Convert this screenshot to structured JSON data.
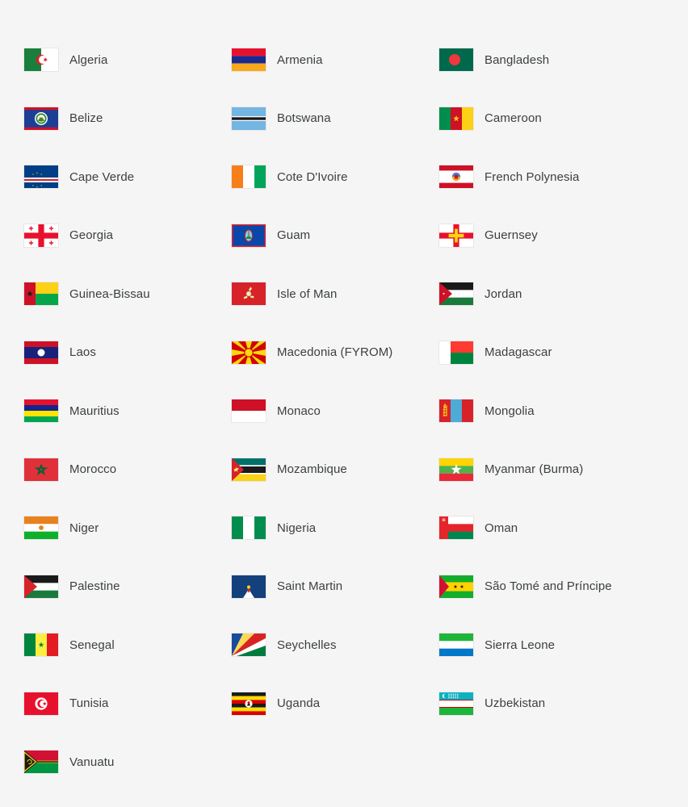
{
  "page": {
    "title": "Country flag list",
    "background_color": "#f5f5f5",
    "text_color": "#3c4043",
    "columns": 3,
    "total_items": 37
  },
  "flags": [
    {
      "name": "Algeria",
      "code": "algeria"
    },
    {
      "name": "Armenia",
      "code": "armenia"
    },
    {
      "name": "Bangladesh",
      "code": "bangladesh"
    },
    {
      "name": "Belize",
      "code": "belize"
    },
    {
      "name": "Botswana",
      "code": "botswana"
    },
    {
      "name": "Cameroon",
      "code": "cameroon"
    },
    {
      "name": "Cape Verde",
      "code": "cape-verde"
    },
    {
      "name": "Cote D'Ivoire",
      "code": "cote-divoire"
    },
    {
      "name": "French Polynesia",
      "code": "french-polynesia"
    },
    {
      "name": "Georgia",
      "code": "georgia"
    },
    {
      "name": "Guam",
      "code": "guam"
    },
    {
      "name": "Guernsey",
      "code": "guernsey"
    },
    {
      "name": "Guinea-Bissau",
      "code": "guinea-bissau"
    },
    {
      "name": "Isle of Man",
      "code": "isle-of-man"
    },
    {
      "name": "Jordan",
      "code": "jordan"
    },
    {
      "name": "Laos",
      "code": "laos"
    },
    {
      "name": "Macedonia (FYROM)",
      "code": "macedonia"
    },
    {
      "name": "Madagascar",
      "code": "madagascar"
    },
    {
      "name": "Mauritius",
      "code": "mauritius"
    },
    {
      "name": "Monaco",
      "code": "monaco"
    },
    {
      "name": "Mongolia",
      "code": "mongolia"
    },
    {
      "name": "Morocco",
      "code": "morocco"
    },
    {
      "name": "Mozambique",
      "code": "mozambique"
    },
    {
      "name": "Myanmar (Burma)",
      "code": "myanmar"
    },
    {
      "name": "Niger",
      "code": "niger"
    },
    {
      "name": "Nigeria",
      "code": "nigeria"
    },
    {
      "name": "Oman",
      "code": "oman"
    },
    {
      "name": "Palestine",
      "code": "palestine"
    },
    {
      "name": "Saint Martin",
      "code": "saint-martin"
    },
    {
      "name": "São Tomé and Príncipe",
      "code": "sao-tome-and-principe"
    },
    {
      "name": "Senegal",
      "code": "senegal"
    },
    {
      "name": "Seychelles",
      "code": "seychelles"
    },
    {
      "name": "Sierra Leone",
      "code": "sierra-leone"
    },
    {
      "name": "Tunisia",
      "code": "tunisia"
    },
    {
      "name": "Uganda",
      "code": "uganda"
    },
    {
      "name": "Uzbekistan",
      "code": "uzbekistan"
    },
    {
      "name": "Vanuatu",
      "code": "vanuatu"
    }
  ],
  "palette": {
    "green_algeria": "#1a7e3c",
    "red": "#d7222a",
    "crimson": "#e8112d",
    "orange": "#f7941e",
    "armenia_blue": "#1b2a8f",
    "bangladesh_green": "#00694b",
    "bangladesh_red": "#f0373e",
    "belize_blue": "#1b3f95",
    "botswana_blue": "#73b5e3",
    "cameroon_green": "#018d4e",
    "cameroon_yellow": "#fcd116",
    "cape_verde_blue": "#003f87",
    "ivory_orange": "#f77f1b",
    "ivory_green": "#00a55a",
    "guam_blue": "#0b47ab",
    "guinea_green": "#05a64b",
    "jordan_black": "#1a1a1a",
    "jordan_green": "#1a7a3c",
    "laos_blue": "#17227a",
    "macedonia_yellow": "#f8d80e",
    "madagascar_red": "#ff3a30",
    "madagascar_green": "#00843d",
    "mauritius_yellow": "#ffe400",
    "monaco_red": "#ce1126",
    "mongolia_blue": "#4eabd6",
    "morocco_red": "#e0303a",
    "mozambique_teal": "#007168",
    "myanmar_yellow": "#ffd400",
    "myanmar_green": "#4eb24e",
    "niger_orange": "#e8821e",
    "nigeria_green": "#018d4e",
    "oman_red": "#e4252b",
    "palestine_green": "#1a7a3c",
    "saint_martin_navy": "#14417c",
    "sao_tome_yellow": "#ffd100",
    "senegal_green": "#00853f",
    "seychelles_blue": "#1a4a9c",
    "sierra_blue": "#0077c8",
    "tunisia_red": "#e8112d",
    "uganda_black": "#1a1a1a",
    "uzbek_teal": "#0bb3c2",
    "uzbek_green": "#1eb53a",
    "vanuatu_red": "#d21034",
    "vanuatu_green": "#009543"
  }
}
